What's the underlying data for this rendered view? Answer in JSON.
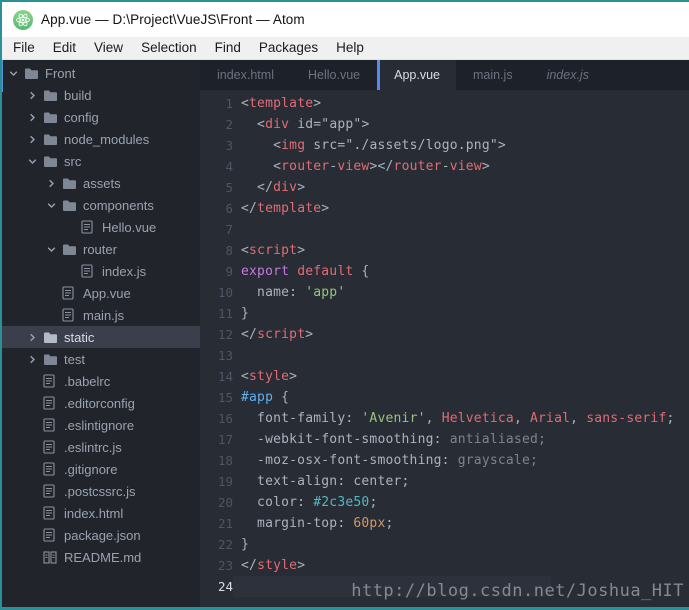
{
  "window": {
    "title": "App.vue — D:\\Project\\VueJS\\Front — Atom",
    "border_color": "#2a8f96",
    "accent_blue": "#568af2"
  },
  "menu_bar": {
    "items": [
      "File",
      "Edit",
      "View",
      "Selection",
      "Find",
      "Packages",
      "Help"
    ]
  },
  "tabs": [
    {
      "label": "index.html",
      "active": false,
      "preview": false
    },
    {
      "label": "Hello.vue",
      "active": false,
      "preview": false
    },
    {
      "label": "App.vue",
      "active": true,
      "preview": false
    },
    {
      "label": "main.js",
      "active": false,
      "preview": false
    },
    {
      "label": "index.js",
      "active": false,
      "preview": true
    }
  ],
  "sidebar": {
    "tree": [
      {
        "label": "Front",
        "level": 0,
        "type": "folder",
        "expanded": true,
        "selected": false
      },
      {
        "label": "build",
        "level": 1,
        "type": "folder",
        "expanded": false,
        "selected": false
      },
      {
        "label": "config",
        "level": 1,
        "type": "folder",
        "expanded": false,
        "selected": false
      },
      {
        "label": "node_modules",
        "level": 1,
        "type": "folder",
        "expanded": false,
        "selected": false
      },
      {
        "label": "src",
        "level": 1,
        "type": "folder",
        "expanded": true,
        "selected": false
      },
      {
        "label": "assets",
        "level": 2,
        "type": "folder",
        "expanded": false,
        "selected": false
      },
      {
        "label": "components",
        "level": 2,
        "type": "folder",
        "expanded": true,
        "selected": false
      },
      {
        "label": "Hello.vue",
        "level": 3,
        "type": "file",
        "selected": false
      },
      {
        "label": "router",
        "level": 2,
        "type": "folder",
        "expanded": true,
        "selected": false
      },
      {
        "label": "index.js",
        "level": 3,
        "type": "file",
        "selected": false
      },
      {
        "label": "App.vue",
        "level": 2,
        "type": "file",
        "selected": false
      },
      {
        "label": "main.js",
        "level": 2,
        "type": "file",
        "selected": false
      },
      {
        "label": "static",
        "level": 1,
        "type": "folder",
        "expanded": false,
        "selected": true
      },
      {
        "label": "test",
        "level": 1,
        "type": "folder",
        "expanded": false,
        "selected": false
      },
      {
        "label": ".babelrc",
        "level": 1,
        "type": "file",
        "selected": false
      },
      {
        "label": ".editorconfig",
        "level": 1,
        "type": "file",
        "selected": false
      },
      {
        "label": ".eslintignore",
        "level": 1,
        "type": "file",
        "selected": false
      },
      {
        "label": ".eslintrc.js",
        "level": 1,
        "type": "file",
        "selected": false
      },
      {
        "label": ".gitignore",
        "level": 1,
        "type": "file",
        "selected": false
      },
      {
        "label": ".postcssrc.js",
        "level": 1,
        "type": "file",
        "selected": false
      },
      {
        "label": "index.html",
        "level": 1,
        "type": "file",
        "selected": false
      },
      {
        "label": "package.json",
        "level": 1,
        "type": "file",
        "selected": false
      },
      {
        "label": "README.md",
        "level": 1,
        "type": "readme",
        "selected": false
      }
    ]
  },
  "editor": {
    "active_line": 24,
    "colors": {
      "def": "#abb2bf",
      "red": "#e06c75",
      "purple": "#c678dd",
      "green": "#98c379",
      "blue": "#61afef",
      "cyan": "#56b6c2",
      "orange": "#d19a66",
      "dim": "#7d848f"
    },
    "lines": [
      [
        [
          "<",
          "def"
        ],
        [
          "template",
          "red"
        ],
        [
          ">",
          "def"
        ]
      ],
      [
        [
          "  <",
          "def"
        ],
        [
          "div",
          "red"
        ],
        [
          " id=\"app\"",
          "def"
        ],
        [
          ">",
          "def"
        ]
      ],
      [
        [
          "    <",
          "def"
        ],
        [
          "img",
          "red"
        ],
        [
          " src=\"./assets/logo.png\"",
          "def"
        ],
        [
          ">",
          "def"
        ]
      ],
      [
        [
          "    <",
          "def"
        ],
        [
          "router",
          "red"
        ],
        [
          "-",
          "def"
        ],
        [
          "view",
          "red"
        ],
        [
          "></",
          "def"
        ],
        [
          "router",
          "red"
        ],
        [
          "-",
          "def"
        ],
        [
          "view",
          "red"
        ],
        [
          ">",
          "def"
        ]
      ],
      [
        [
          "  </",
          "def"
        ],
        [
          "div",
          "red"
        ],
        [
          ">",
          "def"
        ]
      ],
      [
        [
          "</",
          "def"
        ],
        [
          "template",
          "red"
        ],
        [
          ">",
          "def"
        ]
      ],
      [],
      [
        [
          "<",
          "def"
        ],
        [
          "script",
          "red"
        ],
        [
          ">",
          "def"
        ]
      ],
      [
        [
          "export",
          "purple"
        ],
        [
          " ",
          "def"
        ],
        [
          "default",
          "red"
        ],
        [
          " {",
          "def"
        ]
      ],
      [
        [
          "  name: ",
          "def"
        ],
        [
          "'app'",
          "green"
        ]
      ],
      [
        [
          "}",
          "def"
        ]
      ],
      [
        [
          "</",
          "def"
        ],
        [
          "script",
          "red"
        ],
        [
          ">",
          "def"
        ]
      ],
      [],
      [
        [
          "<",
          "def"
        ],
        [
          "style",
          "red"
        ],
        [
          ">",
          "def"
        ]
      ],
      [
        [
          "#app",
          "blue"
        ],
        [
          " {",
          "def"
        ]
      ],
      [
        [
          "  font-family: ",
          "def"
        ],
        [
          "'Avenir'",
          "green"
        ],
        [
          ", ",
          "def"
        ],
        [
          "Helvetica",
          "red"
        ],
        [
          ", ",
          "def"
        ],
        [
          "Arial",
          "red"
        ],
        [
          ", ",
          "def"
        ],
        [
          "sans-serif",
          "red"
        ],
        [
          ";",
          "def"
        ]
      ],
      [
        [
          "  -webkit-font-smoothing: ",
          "def"
        ],
        [
          "antialiased;",
          "dim"
        ]
      ],
      [
        [
          "  -moz-osx-font-smoothing: ",
          "def"
        ],
        [
          "grayscale;",
          "dim"
        ]
      ],
      [
        [
          "  text-align: center;",
          "def"
        ]
      ],
      [
        [
          "  color: ",
          "def"
        ],
        [
          "#2c3e50",
          "cyan"
        ],
        [
          ";",
          "def"
        ]
      ],
      [
        [
          "  margin-top: ",
          "def"
        ],
        [
          "60px",
          "orange"
        ],
        [
          ";",
          "def"
        ]
      ],
      [
        [
          "}",
          "def"
        ]
      ],
      [
        [
          "</",
          "def"
        ],
        [
          "style",
          "red"
        ],
        [
          ">",
          "def"
        ]
      ],
      []
    ]
  },
  "watermark": {
    "text": "http://blog.csdn.net/Joshua_HIT"
  }
}
